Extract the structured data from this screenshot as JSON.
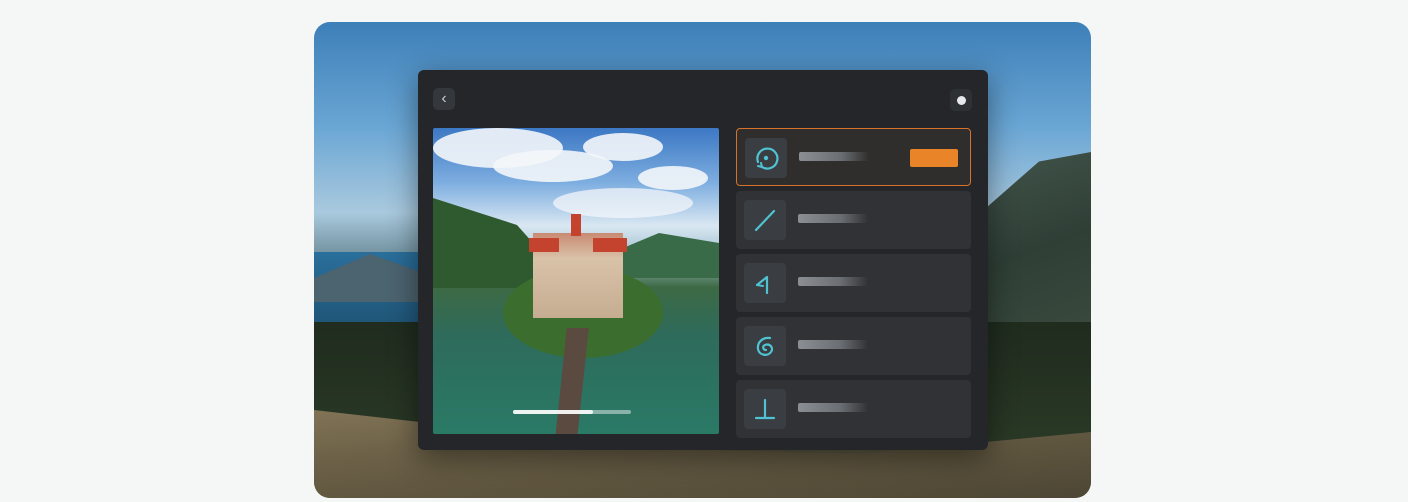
{
  "header": {
    "back_icon": "back-chevron-icon",
    "back_glyph": "‹",
    "settings_icon": "settings-dot-icon"
  },
  "preview": {
    "image_subject": "castle-on-island-aerial",
    "playback_progress": 0.68
  },
  "modes": [
    {
      "icon": "orbit-icon",
      "label": "",
      "selected": true,
      "badge": ""
    },
    {
      "icon": "line-path-icon",
      "label": "",
      "selected": false
    },
    {
      "icon": "rise-path-icon",
      "label": "",
      "selected": false
    },
    {
      "icon": "spiral-icon",
      "label": "",
      "selected": false
    },
    {
      "icon": "vertical-ascend-icon",
      "label": "",
      "selected": false
    }
  ],
  "colors": {
    "accent": "#e98429",
    "icon_stroke": "#4fc3d2",
    "panel_bg": "#242629"
  }
}
